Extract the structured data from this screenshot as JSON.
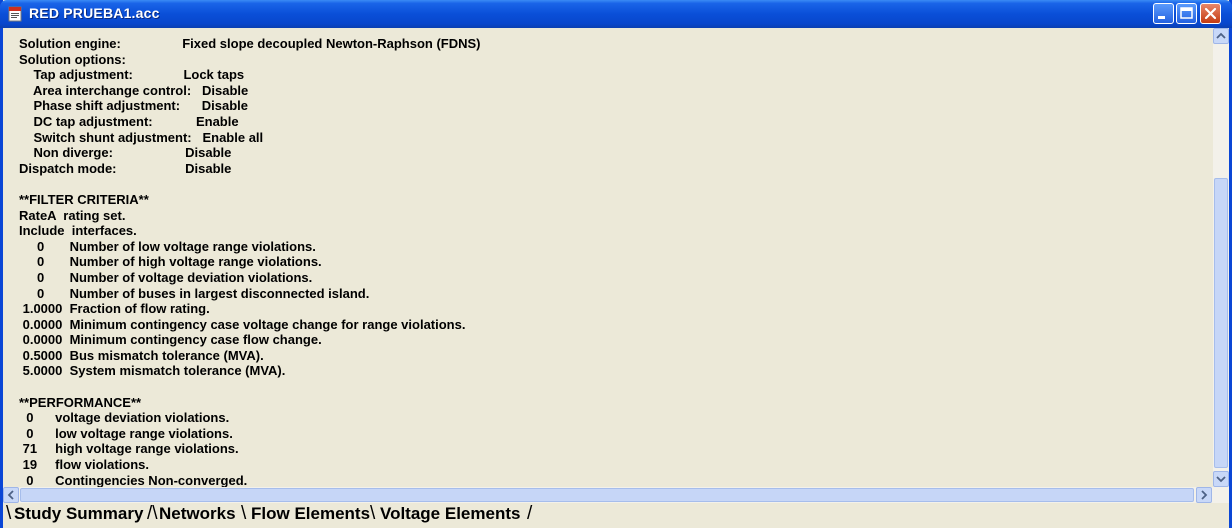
{
  "window": {
    "title": "RED PRUEBA1.acc",
    "app_icon": "document-icon"
  },
  "report": {
    "lines": [
      "Solution engine:                 Fixed slope decoupled Newton-Raphson (FDNS)",
      "Solution options:",
      "    Tap adjustment:              Lock taps",
      "    Area interchange control:   Disable",
      "    Phase shift adjustment:      Disable",
      "    DC tap adjustment:            Enable",
      "    Switch shunt adjustment:   Enable all",
      "    Non diverge:                    Disable",
      "Dispatch mode:                   Disable",
      "",
      "**FILTER CRITERIA**",
      "RateA  rating set.",
      "Include  interfaces.",
      "     0       Number of low voltage range violations.",
      "     0       Number of high voltage range violations.",
      "     0       Number of voltage deviation violations.",
      "     0       Number of buses in largest disconnected island.",
      " 1.0000  Fraction of flow rating.",
      " 0.0000  Minimum contingency case voltage change for range violations.",
      " 0.0000  Minimum contingency case flow change.",
      " 0.5000  Bus mismatch tolerance (MVA).",
      " 5.0000  System mismatch tolerance (MVA).",
      "",
      "**PERFORMANCE**",
      "  0      voltage deviation violations.",
      "  0      low voltage range violations.",
      " 71     high voltage range violations.",
      " 19     flow violations.",
      "  0      Contingencies Non-converged."
    ]
  },
  "tabs": [
    {
      "label": "Study Summary",
      "active": true
    },
    {
      "label": "Networks",
      "active": false
    },
    {
      "label": "Flow Elements",
      "active": false
    },
    {
      "label": "Voltage Elements",
      "active": false
    }
  ],
  "colors": {
    "titlebar": "#0a4fd8",
    "content_bg": "#ece9d8",
    "close_button": "#c43b12"
  }
}
